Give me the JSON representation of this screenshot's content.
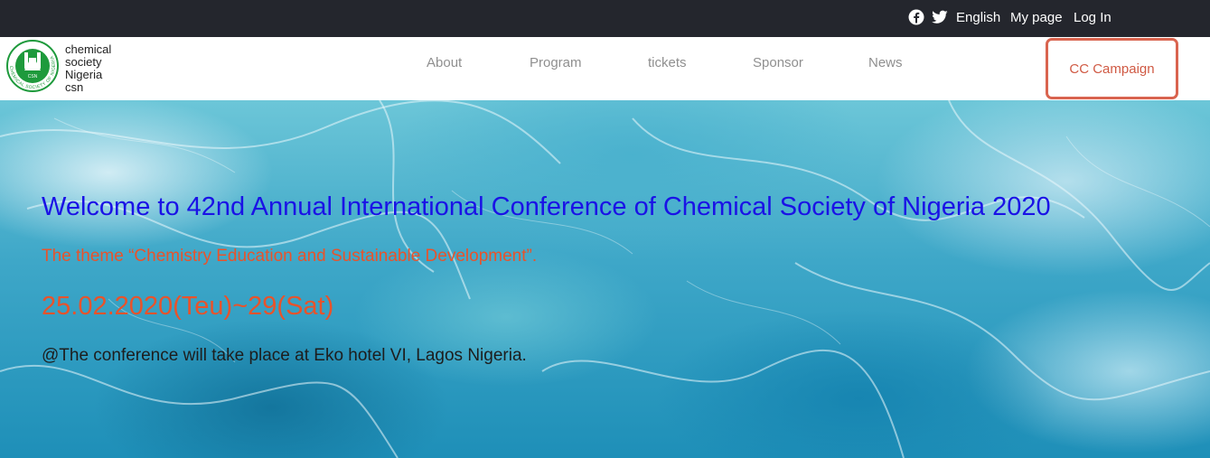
{
  "topbar": {
    "facebook_icon": "facebook-icon",
    "twitter_icon": "twitter-icon",
    "language": "English",
    "mypage": "My page",
    "login": "Log In"
  },
  "brand": {
    "logo_ring_text": "CHEMICAL SOCIETY OF NIGERIA",
    "logo_badge": "CSN",
    "lines": [
      "chemical",
      "society",
      "Nigeria",
      "csn"
    ]
  },
  "nav": {
    "items": [
      "About",
      "Program",
      "tickets",
      "Sponsor",
      "News"
    ],
    "campaign": "CC Campaign"
  },
  "hero": {
    "title": "Welcome to 42nd Annual International Conference of Chemical Society of Nigeria 2020",
    "theme": "The theme “Chemistry Education and Sustainable Development”.",
    "dates": "25.02.2020(Teu)~29(Sat)",
    "venue": "@The conference will take place at Eko hotel VI, Lagos Nigeria."
  },
  "colors": {
    "topbar_bg": "#24262d",
    "title": "#1a12e6",
    "accent": "#e8532b",
    "campaign_border": "#d9644f",
    "logo_green": "#1e9a3c",
    "nav_text": "#8f8f8f"
  }
}
